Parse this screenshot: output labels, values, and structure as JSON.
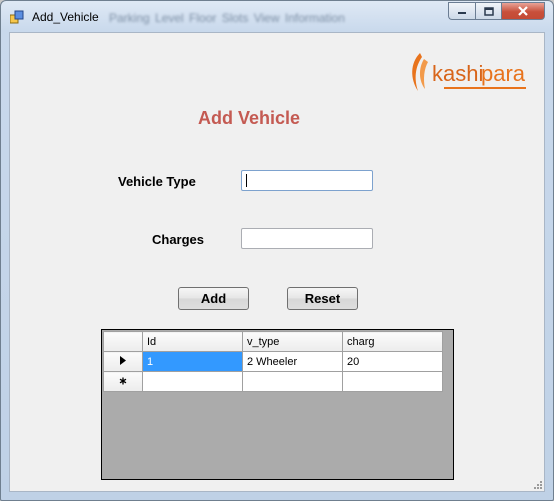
{
  "window": {
    "title": "Add_Vehicle",
    "ghost_menu": "Parking Level   Floor   Slots   View Information"
  },
  "logo": {
    "text_a": "kashi",
    "text_b": "para",
    "accent": "#e8731c"
  },
  "form": {
    "heading": "Add Vehicle",
    "vehicle_type_label": "Vehicle Type",
    "vehicle_type_value": "",
    "charges_label": "Charges",
    "charges_value": "",
    "add_button": "Add",
    "reset_button": "Reset"
  },
  "grid": {
    "columns": [
      "Id",
      "v_type",
      "charg"
    ],
    "rows": [
      {
        "marker": "current",
        "cells": [
          "1",
          "2 Wheeler",
          "20"
        ]
      },
      {
        "marker": "new",
        "cells": [
          "",
          "",
          ""
        ]
      }
    ]
  },
  "icons": {
    "current_row": "triangle-right-icon",
    "new_row": "asterisk-icon"
  }
}
